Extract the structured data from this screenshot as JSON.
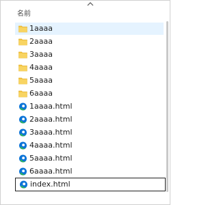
{
  "header": {
    "column_name": "名前"
  },
  "items": [
    {
      "label": "1aaaa",
      "type": "folder",
      "icon": "folder-icon",
      "state": "selected"
    },
    {
      "label": "2aaaa",
      "type": "folder",
      "icon": "folder-icon"
    },
    {
      "label": "3aaaa",
      "type": "folder",
      "icon": "folder-icon"
    },
    {
      "label": "4aaaa",
      "type": "folder",
      "icon": "folder-icon"
    },
    {
      "label": "5aaaa",
      "type": "folder",
      "icon": "folder-icon"
    },
    {
      "label": "6aaaa",
      "type": "folder",
      "icon": "folder-icon"
    },
    {
      "label": "1aaaa.html",
      "type": "file",
      "icon": "edge-html-icon"
    },
    {
      "label": "2aaaa.html",
      "type": "file",
      "icon": "edge-html-icon"
    },
    {
      "label": "3aaaa.html",
      "type": "file",
      "icon": "edge-html-icon"
    },
    {
      "label": "4aaaa.html",
      "type": "file",
      "icon": "edge-html-icon"
    },
    {
      "label": "5aaaa.html",
      "type": "file",
      "icon": "edge-html-icon"
    },
    {
      "label": "6aaaa.html",
      "type": "file",
      "icon": "edge-html-icon"
    },
    {
      "label": "index.html",
      "type": "file",
      "icon": "edge-html-icon",
      "state": "renaming"
    }
  ],
  "colors": {
    "selection": "#e5f3ff",
    "folder": "#f4c542",
    "edge_blue": "#0c74d8",
    "edge_green": "#2fb45a"
  }
}
